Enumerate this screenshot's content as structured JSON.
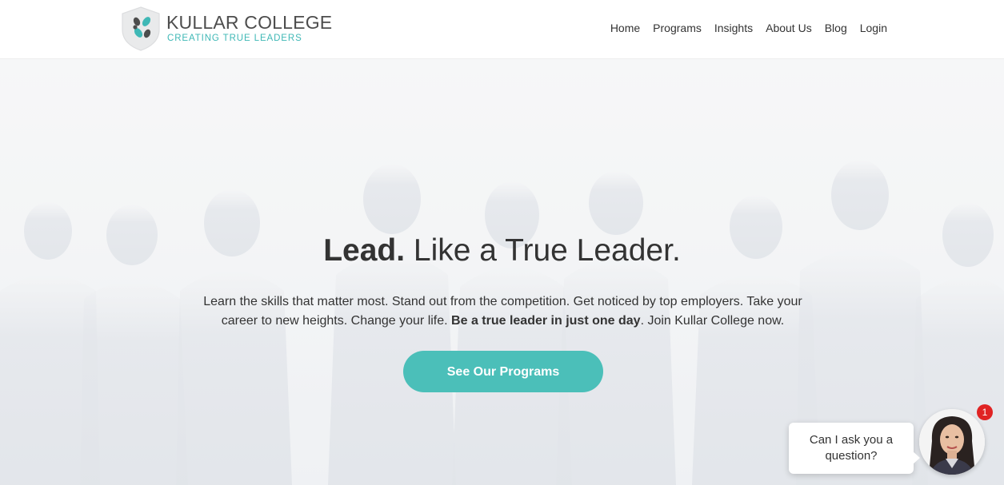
{
  "brand": {
    "name": "KULLAR COLLEGE",
    "tagline": "CREATING TRUE LEADERS",
    "accent_color": "#3fb8b6"
  },
  "nav": {
    "items": [
      {
        "label": "Home"
      },
      {
        "label": "Programs"
      },
      {
        "label": "Insights"
      },
      {
        "label": "About Us"
      },
      {
        "label": "Blog"
      },
      {
        "label": "Login"
      }
    ]
  },
  "hero": {
    "title_strong": "Lead.",
    "title_rest": " Like a True Leader.",
    "text_before": "Learn the skills that matter most. Stand out from the competition. Get noticed by top employers. Take your career to new heights. Change your life. ",
    "text_bold": "Be a true leader in just one day",
    "text_after": ". Join Kullar College now.",
    "cta_label": "See Our Programs",
    "cta_color": "#4bbfb9"
  },
  "chat": {
    "message_line1": "Can I ask you a",
    "message_line2": "question?",
    "badge_count": "1",
    "badge_color": "#e02323"
  }
}
